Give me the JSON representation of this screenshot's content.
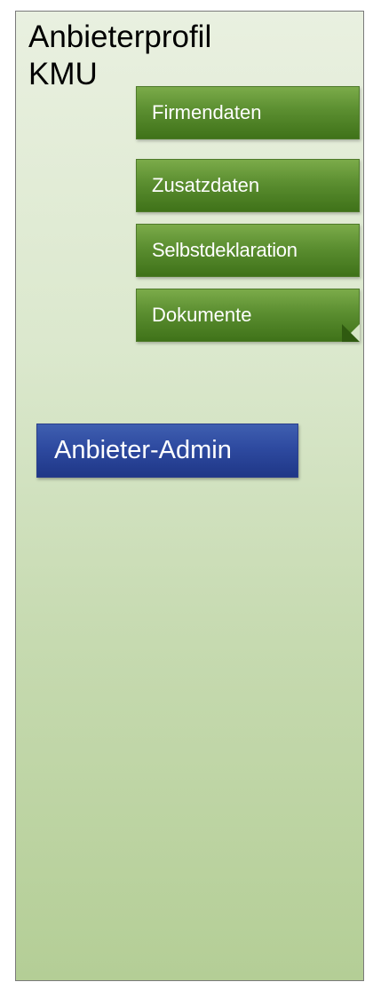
{
  "title": "Anbieterprofil KMU",
  "nav": {
    "items": [
      {
        "label": "Firmendaten"
      },
      {
        "label": "Zusatzdaten"
      },
      {
        "label": "Selbstdeklaration"
      },
      {
        "label": "Dokumente"
      }
    ]
  },
  "admin_button": {
    "label": "Anbieter-Admin"
  },
  "colors": {
    "panel_top": "#e9f0e0",
    "panel_bottom": "#b4ce96",
    "nav_green": "#5b8e30",
    "admin_blue": "#2e4aa0"
  }
}
